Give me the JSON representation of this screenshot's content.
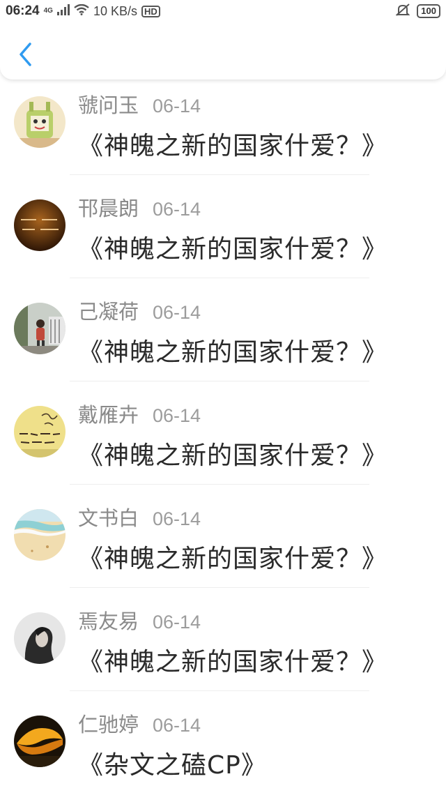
{
  "status_bar": {
    "time": "06:24",
    "network": "4G",
    "speed": "10 KB/s",
    "hd": "HD",
    "battery": "100"
  },
  "header": {
    "back_icon": "chevron-left-icon"
  },
  "accent_color": "#2f9bf0",
  "items": [
    {
      "name": "虢问玉",
      "date": "06-14",
      "title": "《神魄之新的国家什爱？》",
      "avatar": "cartoon-figure-avatar"
    },
    {
      "name": "邗晨朗",
      "date": "06-14",
      "title": "《神魄之新的国家什爱？》",
      "avatar": "dark-text-avatar"
    },
    {
      "name": "己凝荷",
      "date": "06-14",
      "title": "《神魄之新的国家什爱？》",
      "avatar": "child-photo-avatar"
    },
    {
      "name": "戴雁卉",
      "date": "06-14",
      "title": "《神魄之新的国家什爱？》",
      "avatar": "handwriting-avatar"
    },
    {
      "name": "文书白",
      "date": "06-14",
      "title": "《神魄之新的国家什爱？》",
      "avatar": "beach-avatar"
    },
    {
      "name": "焉友易",
      "date": "06-14",
      "title": "《神魄之新的国家什爱？》",
      "avatar": "portrait-bw-avatar"
    },
    {
      "name": "仁驰婷",
      "date": "06-14",
      "title": "《杂文之磕CP》",
      "avatar": "orange-boat-avatar"
    }
  ]
}
